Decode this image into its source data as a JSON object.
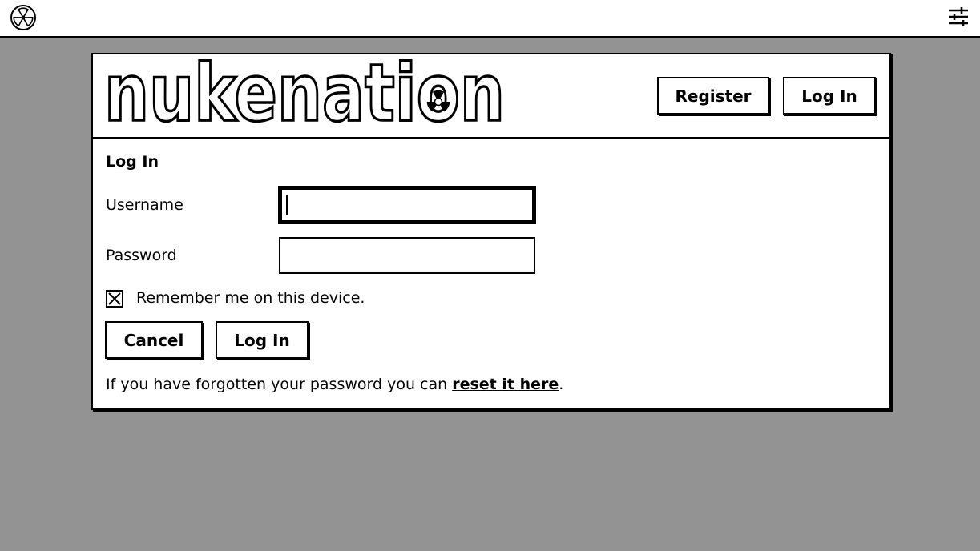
{
  "topbar": {
    "logo_icon": "radiation-icon",
    "settings_icon": "sliders-icon"
  },
  "brand": {
    "name": "nukenation",
    "logo_icon": "radiation-icon"
  },
  "header": {
    "register_label": "Register",
    "login_label": "Log In"
  },
  "form": {
    "title": "Log In",
    "username_label": "Username",
    "username_value": "",
    "password_label": "Password",
    "password_value": "",
    "remember_label": "Remember me on this device.",
    "remember_checked": true,
    "cancel_label": "Cancel",
    "login_label": "Log In",
    "forgot_prefix": "If you have forgotten your password you can ",
    "forgot_link": "reset it here",
    "forgot_suffix": "."
  },
  "colors": {
    "background": "#939393",
    "panel": "#ffffff",
    "border": "#000000"
  }
}
